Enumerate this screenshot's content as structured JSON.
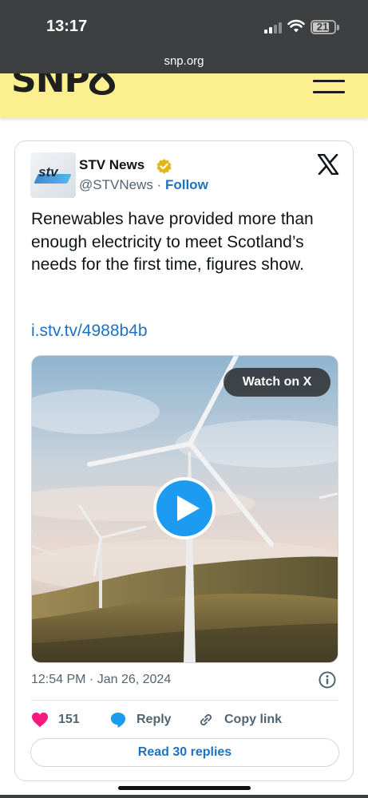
{
  "status": {
    "time": "13:17",
    "battery": "21"
  },
  "browser": {
    "url": "snp.org"
  },
  "site": {
    "logo_text": "SNP"
  },
  "tweet": {
    "author_name": "STV News",
    "handle": "@STVNews",
    "separator": "·",
    "follow_label": "Follow",
    "avatar_text": "stv",
    "text": "Renewables have provided more than enough electricity to meet Scotland’s needs for the first time, figures show.",
    "link": "i.stv.tv/4988b4b",
    "watch_label": "Watch on X",
    "timestamp": "12:54 PM · Jan 26, 2024",
    "likes": "151",
    "reply_label": "Reply",
    "copy_label": "Copy link",
    "read_replies_label": "Read 30 replies"
  },
  "colors": {
    "accent": "#1d9bf0",
    "link": "#1d72c4",
    "like": "#f91880",
    "site_yellow": "#fbef8f",
    "verified_gold": "#e2b719"
  },
  "icons": [
    "wifi-icon",
    "battery-icon",
    "menu-icon",
    "verified-badge-icon",
    "x-logo-icon",
    "play-icon",
    "info-icon",
    "heart-icon",
    "reply-icon",
    "link-icon"
  ]
}
